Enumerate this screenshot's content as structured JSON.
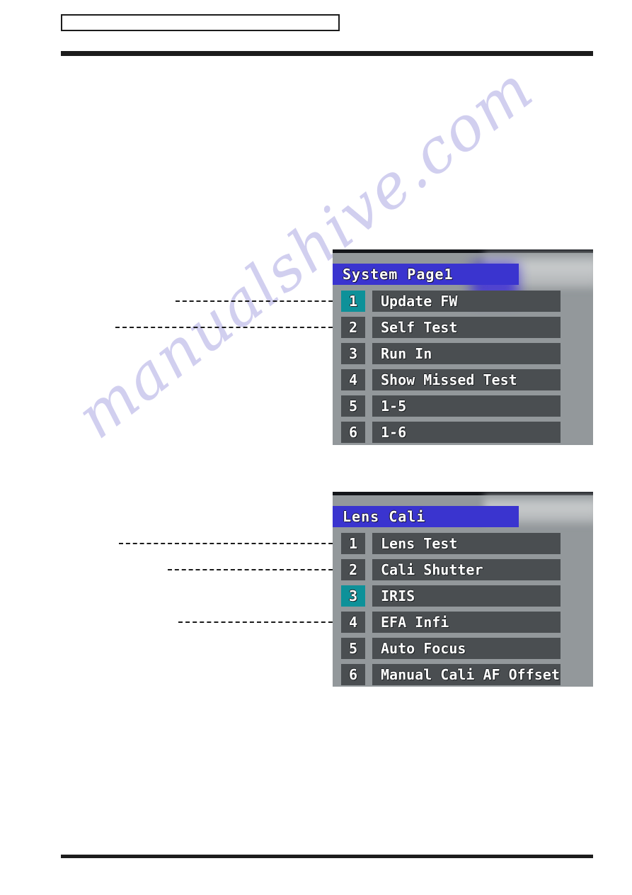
{
  "page": {
    "header_box_text": "",
    "watermark": "manualshive.com"
  },
  "panels": [
    {
      "name": "system-page1",
      "title": "System Page1",
      "rows": [
        {
          "num": "1",
          "label": "Update FW",
          "selected": true,
          "leader": true
        },
        {
          "num": "2",
          "label": "Self Test",
          "selected": false,
          "leader": true
        },
        {
          "num": "3",
          "label": "Run In",
          "selected": false,
          "leader": false
        },
        {
          "num": "4",
          "label": "Show Missed Test",
          "selected": false,
          "leader": false
        },
        {
          "num": "5",
          "label": "1-5",
          "selected": false,
          "leader": false
        },
        {
          "num": "6",
          "label": "1-6",
          "selected": false,
          "leader": false
        }
      ]
    },
    {
      "name": "lens-cali",
      "title": "Lens Cali",
      "rows": [
        {
          "num": "1",
          "label": "Lens Test",
          "selected": false,
          "leader": true
        },
        {
          "num": "2",
          "label": "Cali Shutter",
          "selected": false,
          "leader": true
        },
        {
          "num": "3",
          "label": "IRIS",
          "selected": true,
          "leader": false
        },
        {
          "num": "4",
          "label": "EFA Infi",
          "selected": false,
          "leader": true
        },
        {
          "num": "5",
          "label": "Auto Focus",
          "selected": false,
          "leader": false
        },
        {
          "num": "6",
          "label": "Manual Cali AF Offset",
          "selected": false,
          "leader": false
        }
      ]
    }
  ],
  "colors": {
    "panel_background": "#93989b",
    "title_blue": "#3a34cf",
    "row_gray": "#4a4e51",
    "selected_teal": "#0e9199",
    "rule_black": "#1c1c1c",
    "watermark_lavender": "#cdcaee"
  }
}
